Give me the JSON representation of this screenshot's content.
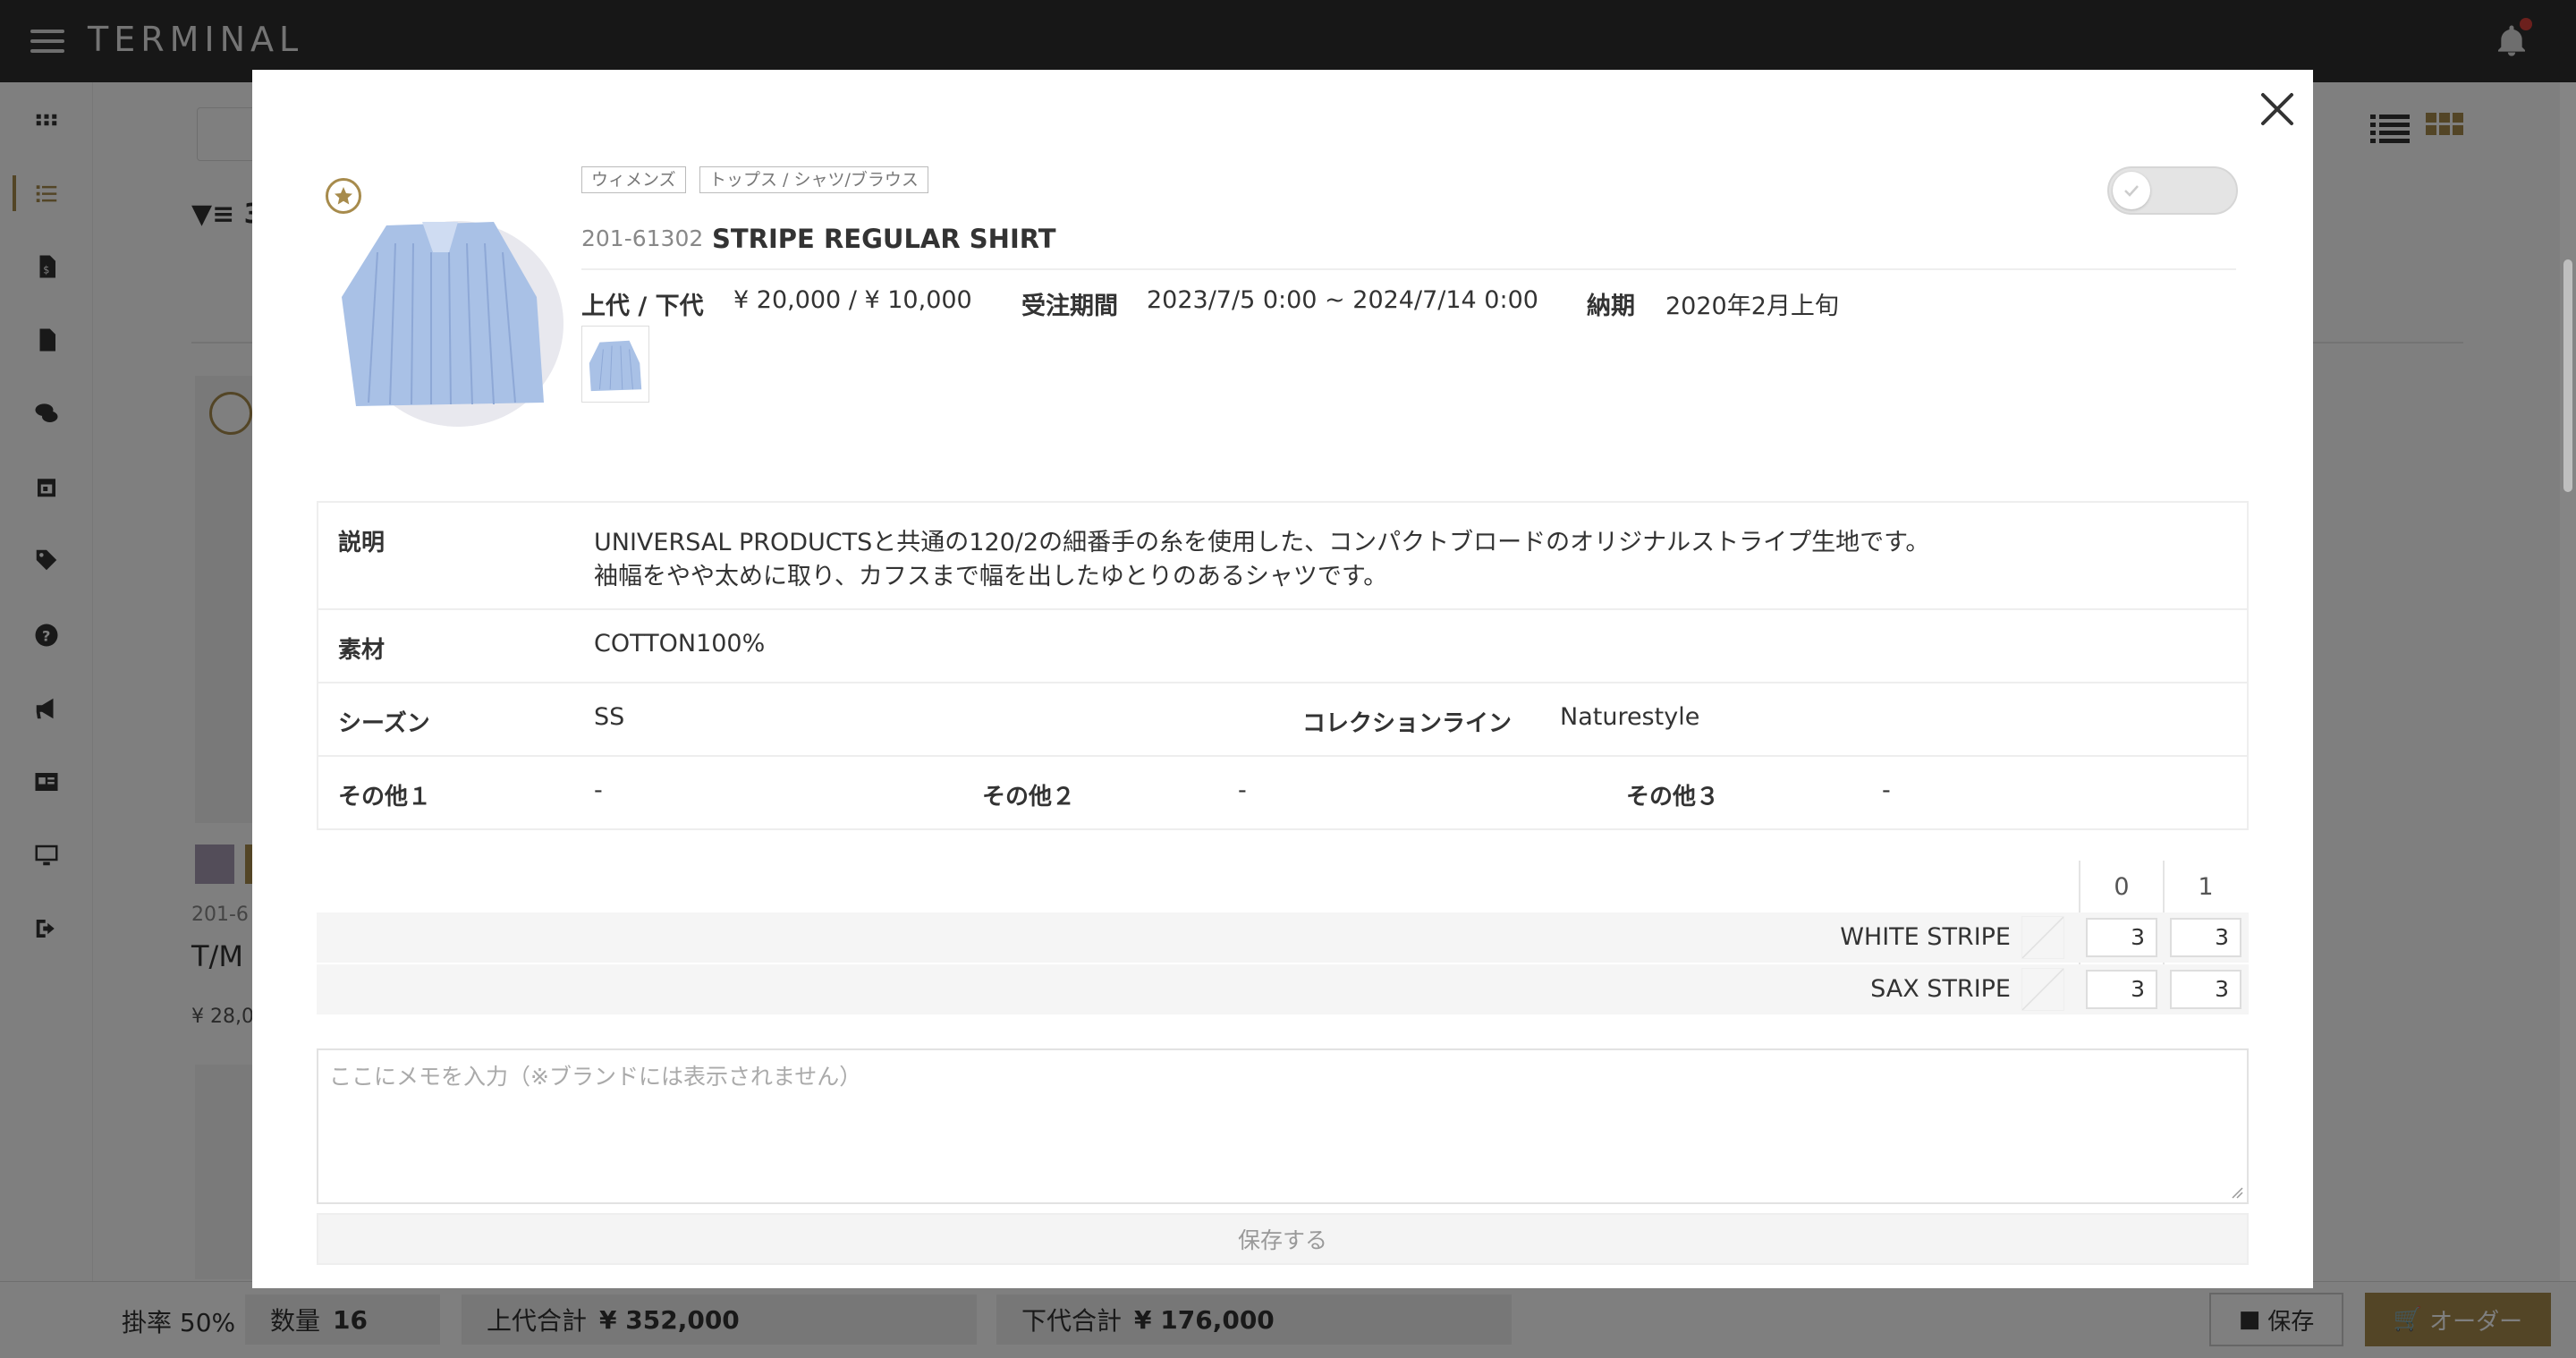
{
  "app": {
    "title": "TERMINAL"
  },
  "background": {
    "filter_count": "3",
    "card_code": "201-6",
    "card_name": "T/M",
    "card_price": "¥ 28,0"
  },
  "bottom_bar": {
    "rate": "掛率 50%",
    "qty_label": "数量",
    "qty_value": "16",
    "upper_total_label": "上代合計",
    "upper_total_value": "¥ 352,000",
    "lower_total_label": "下代合計",
    "lower_total_value": "¥ 176,000",
    "save_label": "保存",
    "order_label": "オーダー"
  },
  "modal": {
    "tags": [
      "ウィメンズ",
      "トップス / シャツ/ブラウス"
    ],
    "product_code": "201-61302",
    "product_name": "STRIPE REGULAR SHIRT",
    "price_label": "上代 / 下代",
    "price_value": "¥ 20,000 / ¥ 10,000",
    "period_label": "受注期間",
    "period_value": "2023/7/5 0:00 ~ 2024/7/14 0:00",
    "delivery_label": "納期",
    "delivery_value": "2020年2月上旬",
    "details": {
      "description_label": "説明",
      "description_line1": "UNIVERSAL PRODUCTSと共通の120/2の細番手の糸を使用した、コンパクトブロードのオリジナルストライプ生地です。",
      "description_line2": "袖幅をやや太めに取り、カフスまで幅を出したゆとりのあるシャツです。",
      "material_label": "素材",
      "material_value": "COTTON100%",
      "season_label": "シーズン",
      "season_value": "SS",
      "collection_label": "コレクションライン",
      "collection_value": "Naturestyle",
      "other1_label": "その他１",
      "other1_value": "-",
      "other2_label": "その他２",
      "other2_value": "-",
      "other3_label": "その他３",
      "other3_value": "-"
    },
    "sizes": [
      "0",
      "1"
    ],
    "colors": [
      {
        "name": "WHITE STRIPE",
        "qty": [
          "3",
          "3"
        ]
      },
      {
        "name": "SAX STRIPE",
        "qty": [
          "3",
          "3"
        ]
      }
    ],
    "memo_placeholder": "ここにメモを入力（※ブランドには表示されません）",
    "save_memo_label": "保存する"
  },
  "colors": {
    "accent": "#a78b4c",
    "topbar": "#2f2f2f",
    "notification": "#d9413a"
  }
}
